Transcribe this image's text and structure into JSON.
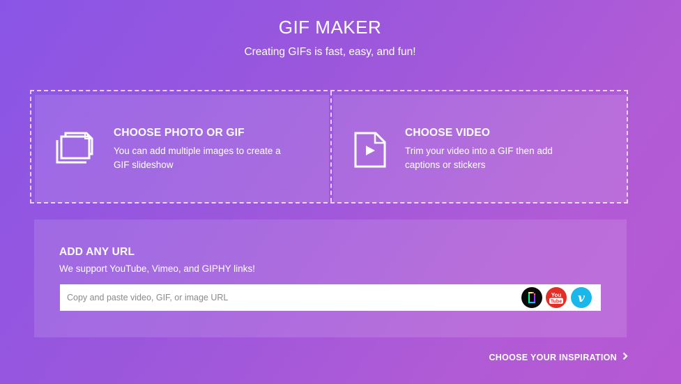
{
  "header": {
    "title": "GIF MAKER",
    "subtitle": "Creating GIFs is fast, easy, and fun!"
  },
  "upload": {
    "photo": {
      "icon": "images-stack-icon",
      "heading": "CHOOSE PHOTO OR GIF",
      "description": "You can add multiple images to create a GIF slideshow"
    },
    "video": {
      "icon": "video-file-icon",
      "heading": "CHOOSE VIDEO",
      "description": "Trim your video into a GIF then add captions or stickers"
    }
  },
  "url_panel": {
    "heading": "ADD ANY URL",
    "subheading": "We support YouTube, Vimeo, and GIPHY links!",
    "placeholder": "Copy and paste video, GIF, or image URL",
    "services": [
      {
        "name": "giphy-icon",
        "color": "#0a0a0a"
      },
      {
        "name": "youtube-icon",
        "color": "#e52d27",
        "label_top": "You",
        "label_bottom": "Tube"
      },
      {
        "name": "vimeo-icon",
        "color": "#1ab7ea",
        "label": "v"
      }
    ]
  },
  "footer": {
    "inspiration_label": "CHOOSE YOUR INSPIRATION",
    "icon": "chevron-right-icon"
  },
  "colors": {
    "bg_start": "#8a55e6",
    "bg_end": "#b658d3",
    "text": "#ffffff"
  }
}
